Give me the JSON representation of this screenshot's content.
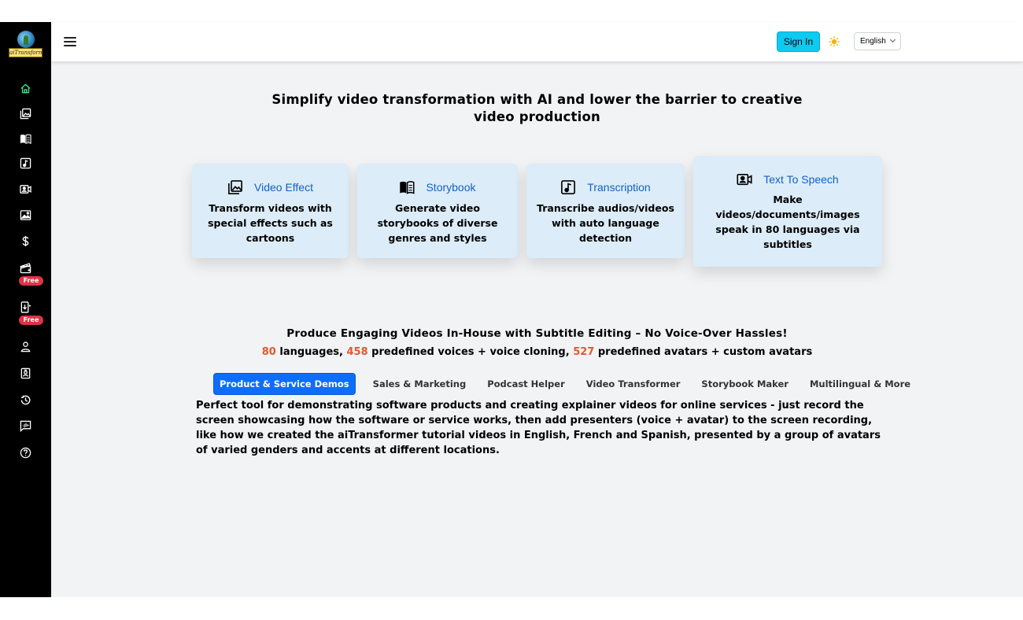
{
  "brand": {
    "logo_text": "aiTransformer"
  },
  "sidebar": {
    "items": [
      {
        "icon": "home-icon",
        "active": true
      },
      {
        "icon": "images-icon"
      },
      {
        "icon": "book-icon"
      },
      {
        "icon": "music-note-icon"
      },
      {
        "icon": "video-person-icon"
      },
      {
        "icon": "image-icon"
      },
      {
        "icon": "dollar-icon"
      },
      {
        "icon": "clapperboard-icon",
        "badge": "Free"
      },
      {
        "icon": "phone-download-icon",
        "badge": "Free"
      },
      {
        "icon": "person-icon"
      },
      {
        "icon": "person-badge-icon"
      },
      {
        "icon": "history-icon"
      },
      {
        "icon": "chat-wave-icon"
      },
      {
        "icon": "help-circle-icon"
      }
    ]
  },
  "header": {
    "signin_label": "Sign In",
    "language": "English"
  },
  "hero": {
    "title": "Simplify video transformation with AI and lower the barrier to creative video production"
  },
  "cards": [
    {
      "icon": "images-icon",
      "title": "Video Effect",
      "desc": "Transform videos with special effects such as cartoons"
    },
    {
      "icon": "book-icon",
      "title": "Storybook",
      "desc": "Generate video storybooks of diverse genres and styles"
    },
    {
      "icon": "music-note-icon",
      "title": "Transcription",
      "desc": "Transcribe audios/videos with auto language detection"
    },
    {
      "icon": "video-person-icon",
      "title": "Text To Speech",
      "desc": "Make videos/documents/images speak in 80 languages via subtitles"
    }
  ],
  "section": {
    "title": "Produce Engaging Videos In-House with Subtitle Editing – No Voice-Over Hassles!",
    "languages_count": "80",
    "languages_text": " languages, ",
    "voices_count": "458",
    "voices_text": " predefined voices + voice cloning, ",
    "avatars_count": "527",
    "avatars_text": " predefined avatars + custom avatars"
  },
  "tabs": [
    {
      "label": "Product & Service Demos",
      "active": true
    },
    {
      "label": "Sales & Marketing"
    },
    {
      "label": "Podcast Helper"
    },
    {
      "label": "Video Transformer"
    },
    {
      "label": "Storybook Maker"
    },
    {
      "label": "Multilingual & More"
    }
  ],
  "demo": {
    "description": "Perfect tool for demonstrating software products and creating explainer videos for online services - just record the screen showcasing how the software or service works, then add presenters (voice + avatar) to the screen recording, like how we created the aiTransformer tutorial videos in English, French and Spanish, presented by a group of avatars of varied genders and accents at different locations."
  },
  "colors": {
    "sidebar_bg": "#000000",
    "active_icon": "#3ddc84",
    "signin_bg": "#0dcaf0",
    "card_bg": "#dcecf8",
    "card_title": "#1261c4",
    "stat_number": "#e4572e",
    "active_tab": "#0d6efd",
    "badge": "#dc3545"
  }
}
